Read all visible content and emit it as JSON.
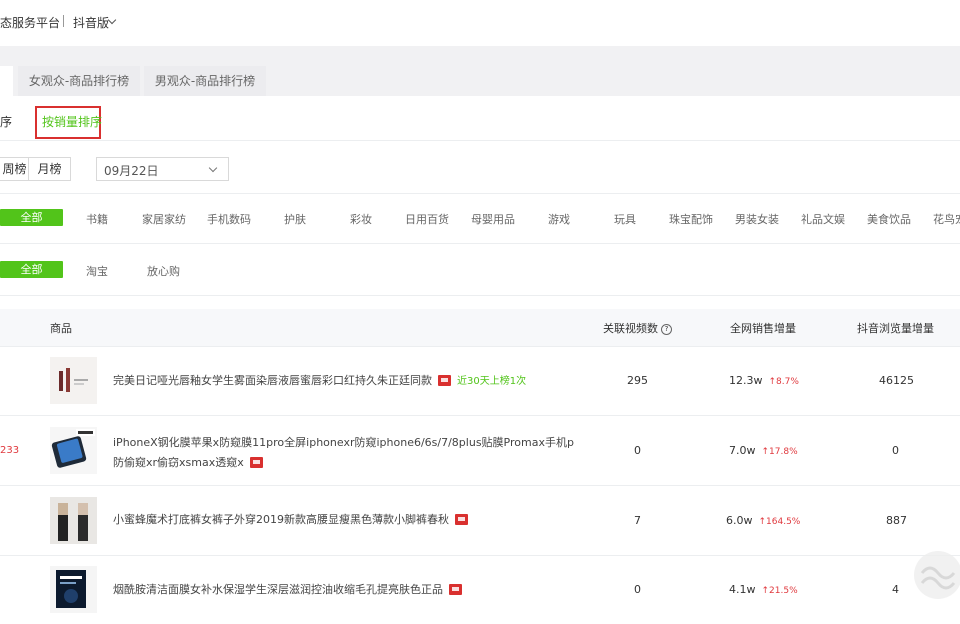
{
  "header": {
    "title": "态服务平台",
    "version_label": "抖音版"
  },
  "tabs": [
    {
      "label": "女观众-商品排行榜"
    },
    {
      "label": "男观众-商品排行榜"
    }
  ],
  "sort": {
    "partial_label": "序",
    "active_label": "按销量排序"
  },
  "period": {
    "weekly_label": "周榜",
    "monthly_label": "月榜",
    "date_value": "09月22日"
  },
  "categories": {
    "all_label": "全部",
    "items": [
      "书籍",
      "家居家纺",
      "手机数码",
      "护肤",
      "彩妆",
      "日用百货",
      "母婴用品",
      "游戏",
      "玩具",
      "珠宝配饰",
      "男装女装",
      "礼品文娱",
      "美食饮品",
      "花鸟宠"
    ]
  },
  "platforms": {
    "all_label": "全部",
    "items": [
      "淘宝",
      "放心购"
    ]
  },
  "table": {
    "headers": {
      "product": "商品",
      "videos": "关联视频数",
      "sales": "全网销售增量",
      "views": "抖音浏览量增量"
    },
    "rows": [
      {
        "rank": "",
        "name": "完美日记哑光唇釉女学生雾面染唇液唇蜜唇彩口红持久朱正廷同款",
        "hot": "近30天上榜1次",
        "videos": "295",
        "sales": "12.3w",
        "growth": "↑8.7%",
        "views": "46125"
      },
      {
        "rank": "233",
        "name": "iPhoneX钢化膜苹果x防窥膜11pro全屏iphonexr防窥iphone6/6s/7/8plus贴膜Promax手机p防偷窥xr偷窃xsmax透窥x",
        "hot": "",
        "videos": "0",
        "sales": "7.0w",
        "growth": "↑17.8%",
        "views": "0"
      },
      {
        "rank": "",
        "name": "小蜜蜂魔术打底裤女裤子外穿2019新款高腰显瘦黑色薄款小脚裤春秋",
        "hot": "",
        "videos": "7",
        "sales": "6.0w",
        "growth": "↑164.5%",
        "views": "887"
      },
      {
        "rank": "",
        "name": "烟酰胺清洁面膜女补水保湿学生深层滋润控油收缩毛孔提亮肤色正品",
        "hot": "",
        "videos": "0",
        "sales": "4.1w",
        "growth": "↑21.5%",
        "views": "4"
      }
    ]
  },
  "colors": {
    "accent_green": "#52c41a",
    "highlight_red": "#d9302f",
    "growth_red": "#e0393e"
  }
}
